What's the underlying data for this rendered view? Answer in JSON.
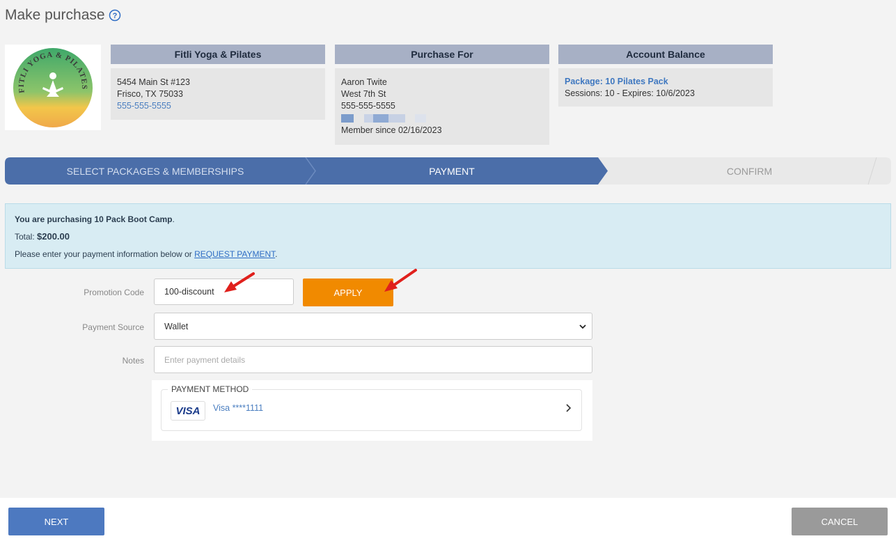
{
  "page": {
    "title": "Make purchase"
  },
  "studio": {
    "header": "Fitli Yoga & Pilates",
    "address1": "5454 Main St #123",
    "address2": "Frisco, TX 75033",
    "phone": "555-555-5555",
    "logo_text": "FITLI YOGA & PILATES"
  },
  "purchase_for": {
    "header": "Purchase For",
    "name": "Aaron Twite",
    "street": "West 7th St",
    "phone": "555-555-5555",
    "member_since": "Member since 02/16/2023"
  },
  "account_balance": {
    "header": "Account Balance",
    "package": "Package: 10 Pilates Pack",
    "sessions": "Sessions: 10 - Expires: 10/6/2023"
  },
  "steps": [
    {
      "label": "SELECT PACKAGES & MEMBERSHIPS"
    },
    {
      "label": "PAYMENT"
    },
    {
      "label": "CONFIRM"
    }
  ],
  "info": {
    "purchasing_prefix": "You are purchasing ",
    "purchasing_item": "10 Pack Boot Camp",
    "purchasing_suffix": ".",
    "total_label": "Total: ",
    "total_value": "$200.00",
    "payment_text": "Please enter your payment information below or ",
    "request_link": "REQUEST PAYMENT",
    "request_suffix": "."
  },
  "form": {
    "promo_label": "Promotion Code",
    "promo_value": "100-discount",
    "apply_label": "APPLY",
    "source_label": "Payment Source",
    "source_value": "Wallet",
    "notes_label": "Notes",
    "notes_placeholder": "Enter payment details"
  },
  "payment_method": {
    "legend": "PAYMENT METHOD",
    "brand": "VISA",
    "card": "Visa ****1111"
  },
  "footer": {
    "next_label": "NEXT",
    "cancel_label": "CANCEL"
  },
  "colors": {
    "accent": "#4b6ea9",
    "apply": "#f18a00",
    "cancel": "#9a9a9a",
    "arrow": "#e0201c"
  }
}
